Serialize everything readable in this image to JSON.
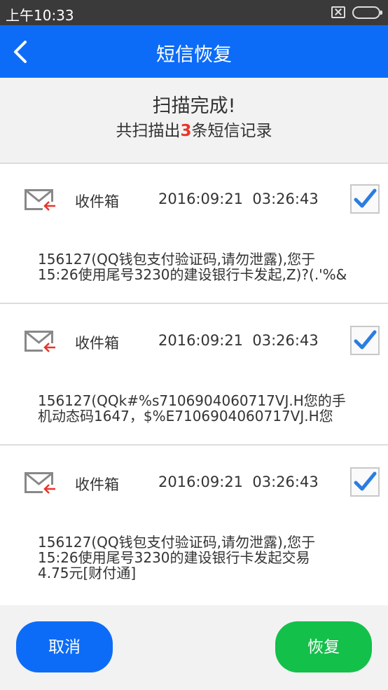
{
  "status_bar": {
    "time": "上午10:33",
    "icons": [
      "sim-icon",
      "battery-icon"
    ]
  },
  "nav": {
    "back_icon": "chevron-left-icon",
    "title": "短信恢复"
  },
  "summary": {
    "line1": "扫描完成!",
    "line2_prefix": "共扫描出",
    "count": "3",
    "line2_suffix": "条短信记录"
  },
  "sms_items": [
    {
      "folder": "收件箱",
      "datetime": "2016:09:21  03:26:43",
      "checked": true,
      "content": "156127(QQ钱包支付验证码,请勿泄露),您于\n15:26使用尾号3230的建设银行卡发起,Z)?(.'%&"
    },
    {
      "folder": "收件箱",
      "datetime": "2016:09:21  03:26:43",
      "checked": true,
      "content": "156127(QQk#%s7106904060717VJ.H您的手\n机动态码1647，$%E7106904060717VJ.H您"
    },
    {
      "folder": "收件箱",
      "datetime": "2016:09:21  03:26:43",
      "checked": true,
      "content": "156127(QQ钱包支付验证码,请勿泄露),您于\n15:26使用尾号3230的建设银行卡发起交易\n4.75元[财付通]"
    }
  ],
  "buttons": {
    "cancel": "取消",
    "restore": "恢复"
  },
  "colors": {
    "nav_blue": "#0c6cf8",
    "count_red": "#e8352a",
    "restore_green": "#13c04a",
    "check_blue": "#2a7de1"
  }
}
